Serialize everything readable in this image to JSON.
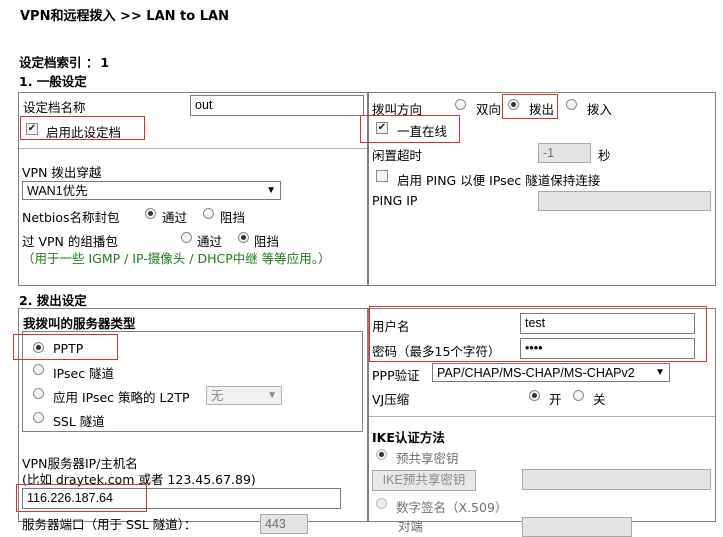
{
  "header": {
    "breadcrumb": "VPN和远程拨入 >> LAN to LAN"
  },
  "profile_index": {
    "label": "设定档索引 ：",
    "value": "1"
  },
  "section1": {
    "title": "1. 一般设定",
    "profile_name_label": "设定档名称",
    "profile_name_value": "out",
    "enable_profile_label": "启用此设定档",
    "vpn_dialout_label": "VPN 拨出穿越",
    "vpn_dialout_selected": "WAN1优先",
    "netbios_label": "Netbios名称封包",
    "pass_label": "通过",
    "block_label": "阻挡",
    "multicast_label": "过 VPN 的组播包",
    "multicast_note": "（用于一些 IGMP / IP-摄像头 / DHCP中继 等等应用。）",
    "dial_direction_label": "拨叫方向",
    "dir_both": "双向",
    "dir_out": "拨出",
    "dir_in": "拨入",
    "always_on_label": "一直在线",
    "idle_timeout_label": "闲置超时",
    "idle_timeout_value": "-1",
    "idle_unit": "秒",
    "ping_keepalive_label": "启用 PING 以便 IPsec 隧道保持连接",
    "ping_ip_label": "PING IP"
  },
  "section2": {
    "title": "2. 拨出设定",
    "server_type_title": "我拨叫的服务器类型",
    "pptp": "PPTP",
    "ipsec": "IPsec 隧道",
    "l2tp": "应用 IPsec 策略的 L2TP",
    "l2tp_select": "无",
    "ssl": "SSL 隧道",
    "server_ip_label": "VPN服务器IP/主机名",
    "server_ip_hint": "(比如 draytek.com 或者 123.45.67.89)",
    "server_ip_value": "116.226.187.64",
    "server_port_label": "服务器端口（用于 SSL 隧道）：",
    "server_port_value": "443",
    "username_label": "用户名",
    "username_value": "test",
    "password_label": "密码（最多15个字符）",
    "password_value": "••••",
    "ppp_auth_label": "PPP验证",
    "ppp_auth_value": "PAP/CHAP/MS-CHAP/MS-CHAPv2",
    "vj_label": "VJ压缩",
    "vj_on": "开",
    "vj_off": "关",
    "ike_title": "IKE认证方法",
    "psk_label": "预共享密钥",
    "psk_button": "IKE预共享密钥",
    "cert_label": "数字签名（X.509）",
    "peer_id_label": "对端"
  }
}
